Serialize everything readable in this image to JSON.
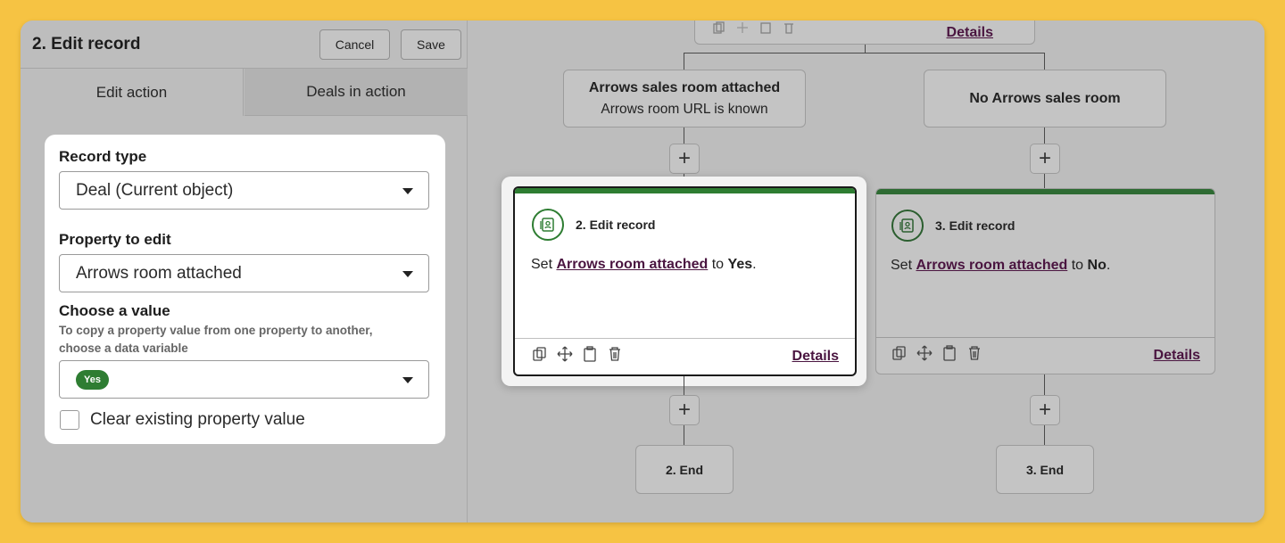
{
  "panel": {
    "title": "2. Edit record",
    "cancel_label": "Cancel",
    "save_label": "Save",
    "tabs": [
      {
        "label": "Edit action",
        "active": true
      },
      {
        "label": "Deals in action",
        "active": false
      }
    ],
    "form": {
      "record_type_label": "Record type",
      "record_type_value": "Deal (Current object)",
      "property_label": "Property to edit",
      "property_value": "Arrows room attached",
      "value_label": "Choose a value",
      "value_hint": "To copy a property value from one property to another, choose a data variable",
      "value_selected": "Yes",
      "clear_label": "Clear existing property value",
      "clear_checked": false
    }
  },
  "workflow": {
    "top_node": {
      "details_label": "Details"
    },
    "branches": [
      {
        "title": "Arrows sales room attached",
        "subtitle": "Arrows room URL is known"
      },
      {
        "title": "No Arrows sales room",
        "subtitle": ""
      }
    ],
    "actions": [
      {
        "title": "2. Edit record",
        "text_prefix": "Set",
        "property": "Arrows room attached",
        "text_mid": "to",
        "value": "Yes",
        "text_suffix": ".",
        "details_label": "Details",
        "selected": true
      },
      {
        "title": "3. Edit record",
        "text_prefix": "Set",
        "property": "Arrows room attached",
        "text_mid": "to",
        "value": "No",
        "text_suffix": ".",
        "details_label": "Details",
        "selected": false
      }
    ],
    "ends": [
      "2. End",
      "3. End"
    ],
    "plus_label": "+"
  },
  "colors": {
    "background": "#f6c343",
    "accent_green": "#2e7d32",
    "link_color": "#4a1540",
    "overlay_gray": "#bdbdbd"
  },
  "icons": [
    "copy-icon",
    "move-icon",
    "clipboard-icon",
    "trash-icon",
    "record-icon",
    "caret-down-icon",
    "plus-icon"
  ]
}
